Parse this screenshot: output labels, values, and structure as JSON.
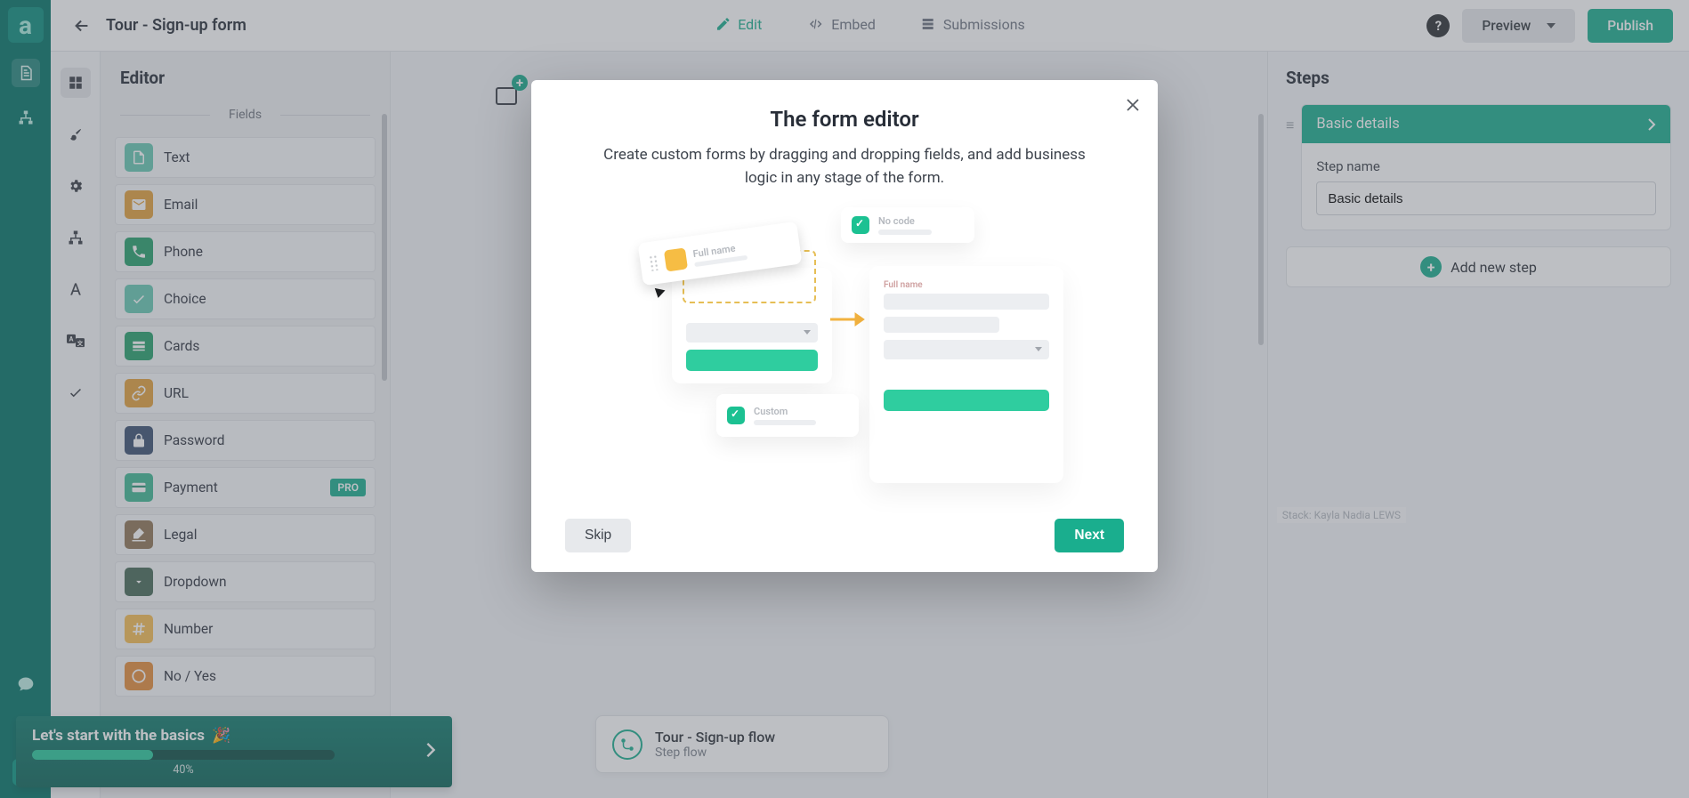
{
  "topbar": {
    "title": "Tour - Sign-up form",
    "tabs": {
      "edit": "Edit",
      "embed": "Embed",
      "submissions": "Submissions"
    },
    "preview": "Preview",
    "publish": "Publish"
  },
  "editor": {
    "title": "Editor",
    "section_fields": "Fields",
    "fields": [
      {
        "label": "Text",
        "icon": "text",
        "color": "#67c9b3"
      },
      {
        "label": "Email",
        "icon": "email",
        "color": "#e3a13b"
      },
      {
        "label": "Phone",
        "icon": "phone",
        "color": "#25a06b"
      },
      {
        "label": "Choice",
        "icon": "choice",
        "color": "#67c9b3"
      },
      {
        "label": "Cards",
        "icon": "cards",
        "color": "#25a06b"
      },
      {
        "label": "URL",
        "icon": "url",
        "color": "#e3a13b"
      },
      {
        "label": "Password",
        "icon": "password",
        "color": "#3b5172"
      },
      {
        "label": "Payment",
        "icon": "payment",
        "color": "#3fb793",
        "pro": "PRO"
      },
      {
        "label": "Legal",
        "icon": "legal",
        "color": "#8f7655"
      },
      {
        "label": "Dropdown",
        "icon": "dropdown",
        "color": "#466a57"
      },
      {
        "label": "Number",
        "icon": "number",
        "color": "#f5bd53"
      },
      {
        "label": "No / Yes",
        "icon": "noyes",
        "color": "#e58d3a"
      }
    ]
  },
  "onboard": {
    "title": "Let's start with the basics",
    "progress_pct": 40,
    "progress_label": "40%"
  },
  "flow_card": {
    "title": "Tour - Sign-up flow",
    "subtitle": "Step flow"
  },
  "steps": {
    "title": "Steps",
    "current_step_title": "Basic details",
    "step_name_label": "Step name",
    "step_name_value": "Basic details",
    "add_new": "Add new step"
  },
  "modal": {
    "title": "The form editor",
    "body": "Create custom forms by dragging and dropping fields, and add business logic in any stage of the form.",
    "skip": "Skip",
    "next": "Next",
    "illus": {
      "drag_label": "Full name",
      "pill_custom": "Custom",
      "pill_nocode": "No code",
      "c2_label": "Full name"
    }
  },
  "watermark": "Stack: Kayla Nadia LEWS"
}
